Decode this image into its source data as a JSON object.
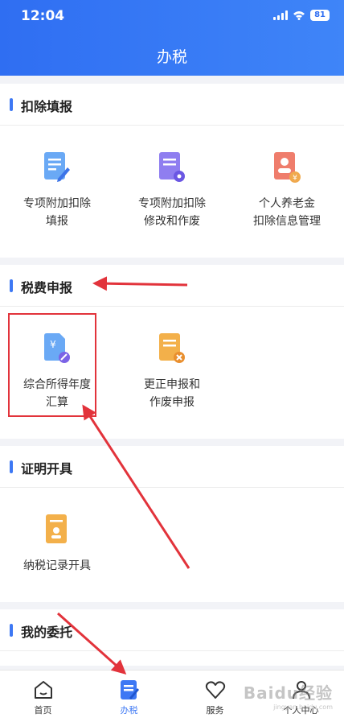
{
  "status": {
    "time": "12:04",
    "battery": "81"
  },
  "header": {
    "title": "办税"
  },
  "sections": [
    {
      "title": "扣除填报",
      "items": [
        {
          "label": "专项附加扣除填报",
          "line1": "专项附加扣除",
          "line2": "填报"
        },
        {
          "label": "专项附加扣除修改和作废",
          "line1": "专项附加扣除",
          "line2": "修改和作废"
        },
        {
          "label": "个人养老金扣除信息管理",
          "line1": "个人养老金",
          "line2": "扣除信息管理"
        }
      ]
    },
    {
      "title": "税费申报",
      "items": [
        {
          "label": "综合所得年度汇算",
          "line1": "综合所得年度",
          "line2": "汇算"
        },
        {
          "label": "更正申报和作废申报",
          "line1": "更正申报和",
          "line2": "作废申报"
        }
      ]
    },
    {
      "title": "证明开具",
      "items": [
        {
          "label": "纳税记录开具",
          "line1": "纳税记录开具",
          "line2": ""
        }
      ]
    },
    {
      "title": "我的委托",
      "items": []
    }
  ],
  "tabs": [
    {
      "label": "首页",
      "icon": "home-icon"
    },
    {
      "label": "办税",
      "icon": "tax-form-icon",
      "active": true
    },
    {
      "label": "服务",
      "icon": "service-heart-icon"
    },
    {
      "label": "个人中心",
      "icon": "user-icon"
    }
  ],
  "watermark": {
    "line1": "Baidu经验",
    "line2": "jingyan.baidu.com"
  },
  "colors": {
    "brand": "#3d78f4",
    "annotation": "#e2333b"
  }
}
